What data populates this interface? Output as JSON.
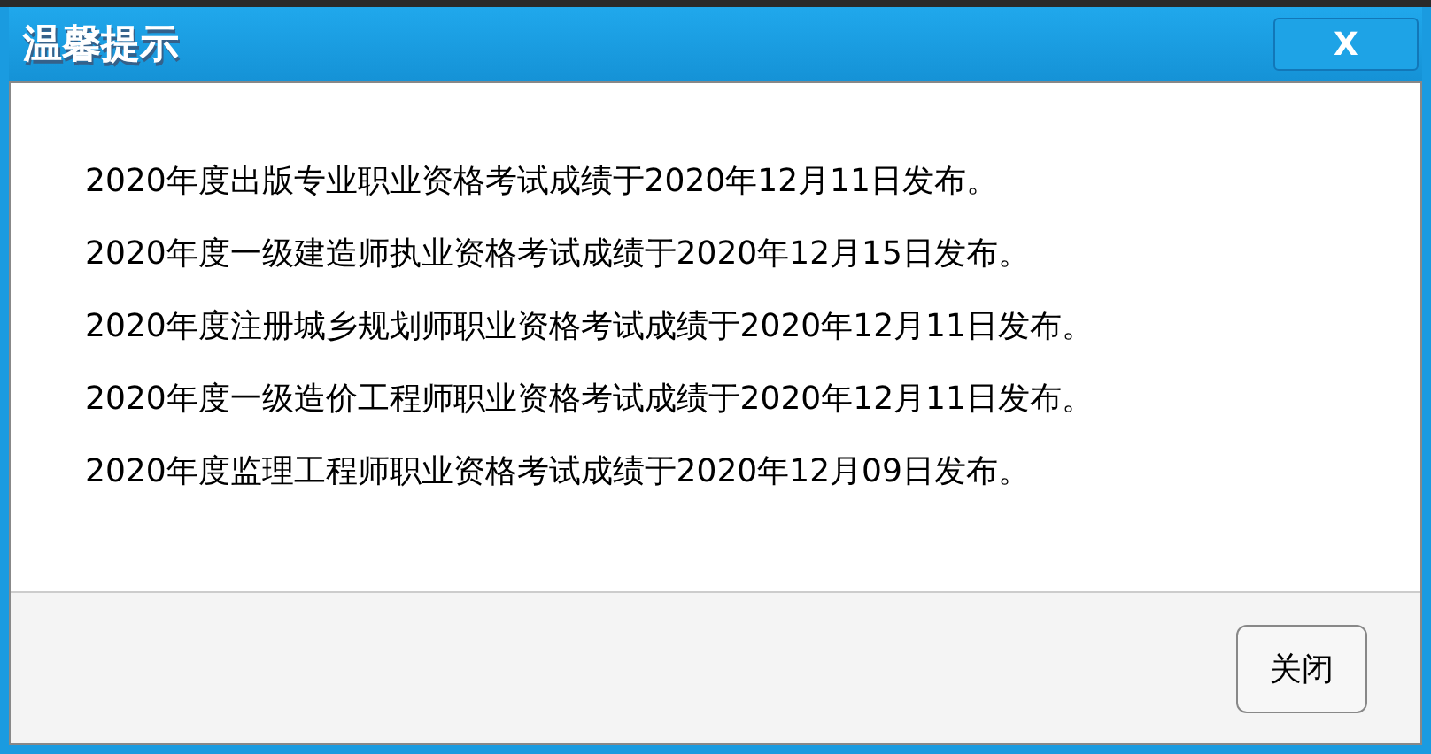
{
  "window": {
    "title": "温馨提示",
    "close": "X"
  },
  "messages": [
    "2020年度出版专业职业资格考试成绩于2020年12月11日发布。",
    "2020年度一级建造师执业资格考试成绩于2020年12月15日发布。",
    "2020年度注册城乡规划师职业资格考试成绩于2020年12月11日发布。",
    "2020年度一级造价工程师职业资格考试成绩于2020年12月11日发布。",
    "2020年度监理工程师职业资格考试成绩于2020年12月09日发布。"
  ],
  "buttons": [
    "关闭"
  ]
}
